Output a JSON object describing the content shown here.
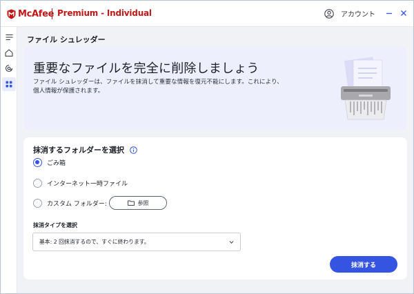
{
  "app": {
    "brand": "McAfee",
    "product": "Premium - Individual",
    "account_label": "アカウント"
  },
  "sidebar": {
    "items": [
      {
        "icon": "menu-icon"
      },
      {
        "icon": "home-icon"
      },
      {
        "icon": "privacy-icon"
      },
      {
        "icon": "apps-grid-icon",
        "active": true
      }
    ]
  },
  "page": {
    "title": "ファイル シュレッダー"
  },
  "hero": {
    "heading": "重要なファイルを完全に削除しましょう",
    "description": "ファイル シュレッダーは、ファイルを抹消して重要な情報を復元不能にします。これにより、個人情報が保護されます。"
  },
  "folder_select": {
    "title": "抹消するフォルダーを選択",
    "options": [
      {
        "label": "ごみ箱",
        "checked": true
      },
      {
        "label": "インターネット一時ファイル",
        "checked": false
      },
      {
        "label": "カスタム フォルダー:",
        "checked": false
      }
    ],
    "browse_label": "参照"
  },
  "shred_type": {
    "label": "抹消タイプを選択",
    "selected": "基本: 2 回抹消するので、すぐに終わります。"
  },
  "actions": {
    "shred_label": "抹消する"
  },
  "colors": {
    "brand_red": "#c01818",
    "accent_blue": "#3554e2",
    "hero_bg": "#eeeffd"
  }
}
